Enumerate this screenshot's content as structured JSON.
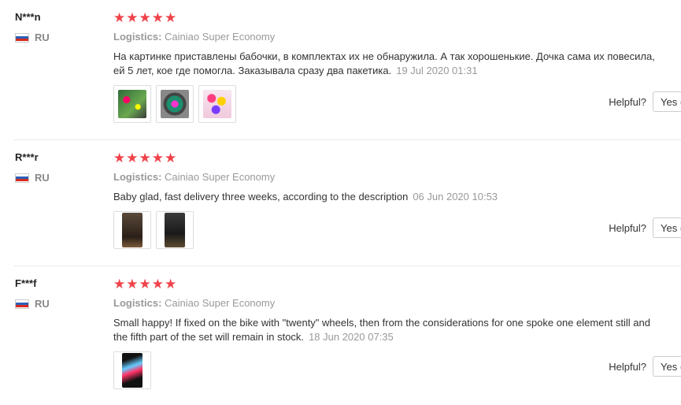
{
  "helpful_label": "Helpful?",
  "yes_label": "Yes (",
  "logistics_label": "Logistics:",
  "stars_text": "★★★★★",
  "reviews": [
    {
      "user": "N***n",
      "country": "RU",
      "rating": 5,
      "logistics": "Cainiao Super Economy",
      "text": "На картинке приставлены бабочки, в комплектах их не обнаружила. А так хорошенькие. Дочка сама их повесила, ей 5 лет, кое где помогла. Заказывала сразу два пакетика.",
      "date": "19 Jul 2020 01:31",
      "photo_count": 3
    },
    {
      "user": "R***r",
      "country": "RU",
      "rating": 5,
      "logistics": "Cainiao Super Economy",
      "text": "Baby glad, fast delivery three weeks, according to the description",
      "date": "06 Jun 2020 10:53",
      "photo_count": 2
    },
    {
      "user": "F***f",
      "country": "RU",
      "rating": 5,
      "logistics": "Cainiao Super Economy",
      "text": "Small happy! If fixed on the bike with \"twenty\" wheels, then from the considerations for one spoke one element still and the fifth part of the set will remain in stock.",
      "date": "18 Jun 2020 07:35",
      "photo_count": 1
    }
  ],
  "colors": {
    "star": "#f0424a",
    "muted": "#999999",
    "text": "#333333",
    "divider": "#e8e8e8"
  }
}
